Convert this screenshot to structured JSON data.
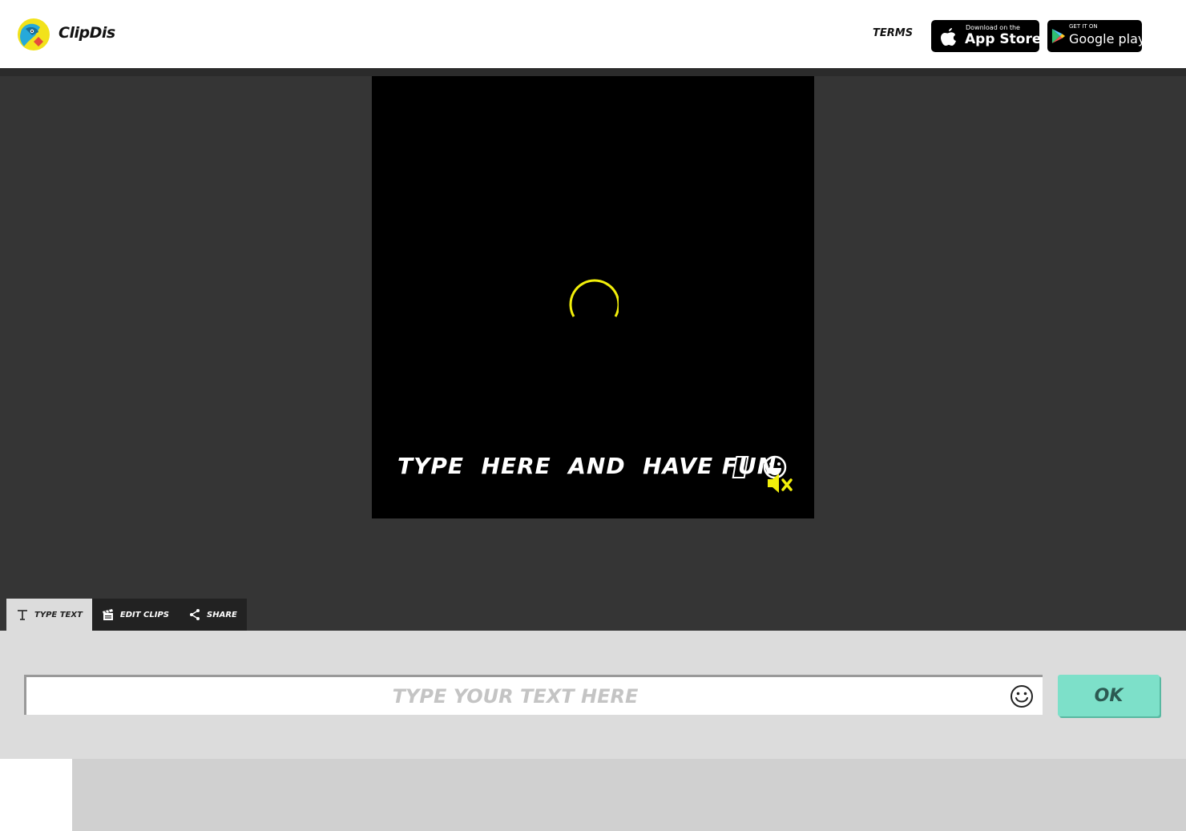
{
  "header": {
    "brand": "ClipDis",
    "terms_label": "TERMS",
    "app_store": {
      "small": "Download on the",
      "big": "App Store"
    },
    "google_play": {
      "small": "GET IT ON",
      "big": "Google play"
    }
  },
  "video": {
    "caption": "TYPE  HERE  AND  HAVE FUN",
    "state": "loading",
    "muted": true
  },
  "tabs": [
    {
      "label": "TYPE TEXT",
      "icon": "text-icon",
      "active": true
    },
    {
      "label": "EDIT CLIPS",
      "icon": "clapperboard-icon",
      "active": false
    },
    {
      "label": "SHARE",
      "icon": "share-icon",
      "active": false
    }
  ],
  "input": {
    "placeholder": "TYPE YOUR TEXT HERE",
    "value": ""
  },
  "ok_label": "OK",
  "colors": {
    "accent_yellow": "#f2ef0a",
    "ok_button": "#7de0c9",
    "editor_bg": "#353535",
    "panel_bg": "#dcdcdc"
  }
}
